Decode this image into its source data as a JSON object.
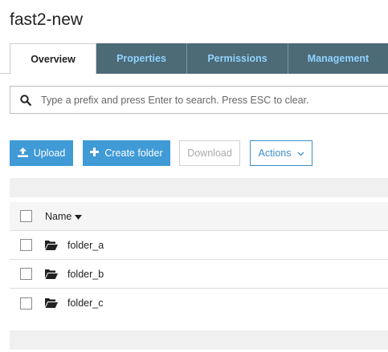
{
  "page": {
    "title": "fast2-new"
  },
  "tabs": [
    {
      "label": "Overview",
      "active": true
    },
    {
      "label": "Properties",
      "active": false
    },
    {
      "label": "Permissions",
      "active": false
    },
    {
      "label": "Management",
      "active": false
    }
  ],
  "search": {
    "placeholder": "Type a prefix and press Enter to search. Press ESC to clear.",
    "value": "",
    "icon": "search-icon"
  },
  "toolbar": {
    "upload_label": "Upload",
    "create_folder_label": "Create folder",
    "download_label": "Download",
    "actions_label": "Actions"
  },
  "table": {
    "name_header": "Name",
    "sort": "descending",
    "rows": [
      {
        "label": "folder_a",
        "icon": "folder-open-icon"
      },
      {
        "label": "folder_b",
        "icon": "folder-open-icon"
      },
      {
        "label": "folder_c",
        "icon": "folder-open-icon"
      }
    ]
  },
  "colors": {
    "accent": "#3f9ad6",
    "tab_inactive_bg": "#4d6a77",
    "tab_inactive_text": "#8fd3ff"
  }
}
